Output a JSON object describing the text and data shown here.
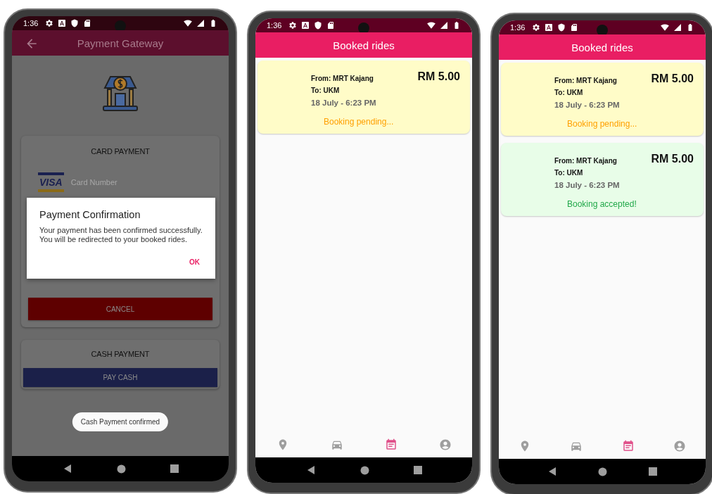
{
  "phones": [
    {
      "kind": "payment",
      "status_time": "1:36",
      "app_bar": {
        "title": "Payment Gateway",
        "back": true
      },
      "card_payment": {
        "title": "CARD PAYMENT",
        "card_brand": "VISA",
        "card_number_placeholder": "Card Number",
        "cancel_button": "CANCEL"
      },
      "cash_payment": {
        "title": "CASH PAYMENT",
        "button": "PAY CASH"
      },
      "dialog": {
        "title": "Payment Confirmation",
        "message": "Your payment has been confirmed successfully. You will be redirected to your booked rides.",
        "button": "OK"
      },
      "toast": "Cash Payment confirmed"
    },
    {
      "kind": "rides",
      "status_time": "1:36",
      "app_bar": {
        "title": "Booked rides"
      },
      "rides": [
        {
          "from": "From: MRT Kajang",
          "to": "To: UKM",
          "datetime": "18 July - 6:23 PM",
          "price": "RM 5.00",
          "status": "Booking pending...",
          "kind": "pending"
        }
      ],
      "nav": [
        {
          "kind": "location",
          "selected": false
        },
        {
          "kind": "car",
          "selected": false
        },
        {
          "kind": "calendar",
          "selected": true
        },
        {
          "kind": "account",
          "selected": false
        }
      ]
    },
    {
      "kind": "rides",
      "status_time": "1:36",
      "app_bar": {
        "title": "Booked rides"
      },
      "rides": [
        {
          "from": "From: MRT Kajang",
          "to": "To: UKM",
          "datetime": "18 July - 6:23 PM",
          "price": "RM 5.00",
          "status": "Booking pending...",
          "kind": "pending"
        },
        {
          "from": "From: MRT Kajang",
          "to": "To: UKM",
          "datetime": "18 July - 6:23 PM",
          "price": "RM 5.00",
          "status": "Booking accepted!",
          "kind": "accepted"
        }
      ],
      "nav": [
        {
          "kind": "location",
          "selected": false
        },
        {
          "kind": "car",
          "selected": false
        },
        {
          "kind": "calendar",
          "selected": true
        },
        {
          "kind": "account",
          "selected": false
        }
      ]
    }
  ]
}
